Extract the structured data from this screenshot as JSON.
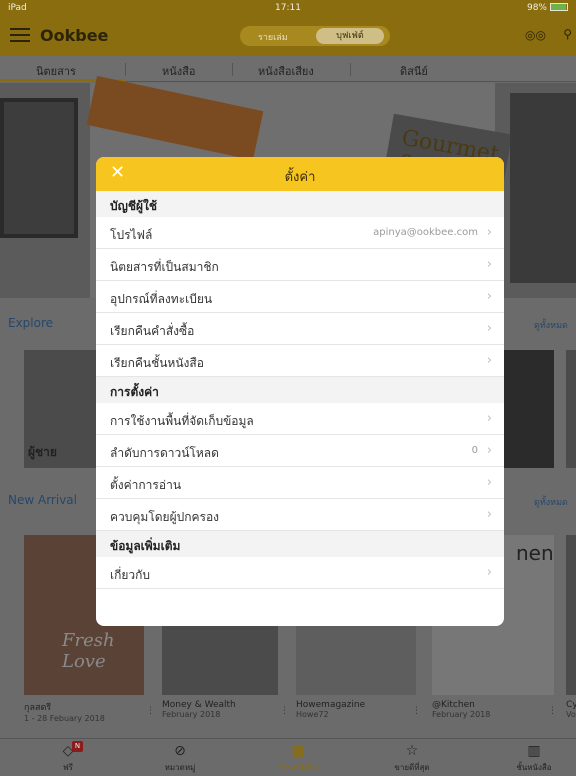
{
  "status": {
    "device": "iPad",
    "time": "17:11",
    "battery": "98%"
  },
  "header": {
    "brand": "Ookbee",
    "segments": [
      "รายเล่ม",
      "บุฟเฟ่ต์"
    ]
  },
  "tabs": [
    "นิตยสาร",
    "หนังสือ",
    "หนังสือเสียง",
    "ดิสนีย์"
  ],
  "sections": {
    "explore": {
      "title": "Explore",
      "see_all": "ดูทั้งหมด",
      "card_label": "ผู้ชาย"
    },
    "new_arrival": {
      "title": "New Arrival",
      "see_all": "ดูทั้งหมด"
    }
  },
  "new_arrivals": [
    {
      "title": "กุลสตรี",
      "subtitle": "1 - 28 Febuary 2018"
    },
    {
      "title": "Money & Wealth",
      "subtitle": "February 2018"
    },
    {
      "title": "Howemagazine",
      "subtitle": "Howe72"
    },
    {
      "title": "@Kitchen",
      "subtitle": "February 2018"
    },
    {
      "title": "Cy",
      "subtitle": "Vo"
    }
  ],
  "banner_text": {
    "gourmet": "Gourmet & Cuisine"
  },
  "cover_text": {
    "fresh": "Fresh Love",
    "nen": "nen"
  },
  "bottom_nav": [
    {
      "label": "ฟรี",
      "icon": "tag-icon",
      "badge": "N"
    },
    {
      "label": "หมวดหมู่",
      "icon": "compass-icon"
    },
    {
      "label": "ร้านหนังสือ",
      "icon": "store-icon"
    },
    {
      "label": "ขายดีที่สุด",
      "icon": "star-icon"
    },
    {
      "label": "ชั้นหนังสือ",
      "icon": "bookshelf-icon"
    }
  ],
  "modal": {
    "title": "ตั้งค่า",
    "account_header": "บัญชีผู้ใช้",
    "profile": {
      "label": "โปรไฟล์",
      "value": "apinya@ookbee.com"
    },
    "subscribed": "นิตยสารที่เป็นสมาชิก",
    "devices": "อุปกรณ์ที่ลงทะเบียน",
    "restore_orders": "เรียกคืนคำสั่งซื้อ",
    "restore_shelf": "เรียกคืนชั้นหนังสือ",
    "settings_header": "การตั้งค่า",
    "storage": "การใช้งานพื้นที่จัดเก็บข้อมูล",
    "download_queue": {
      "label": "ลำดับการดาวน์โหลด",
      "value": "0"
    },
    "reading": "ตั้งค่าการอ่าน",
    "parental": "ควบคุมโดยผู้ปกครอง",
    "more_header": "ข้อมูลเพิ่มเติม",
    "about": "เกี่ยวกับ"
  },
  "colors": {
    "accent": "#f7c51f",
    "link": "#2a5b8f",
    "dim_overlay": "#6b6b6b"
  }
}
